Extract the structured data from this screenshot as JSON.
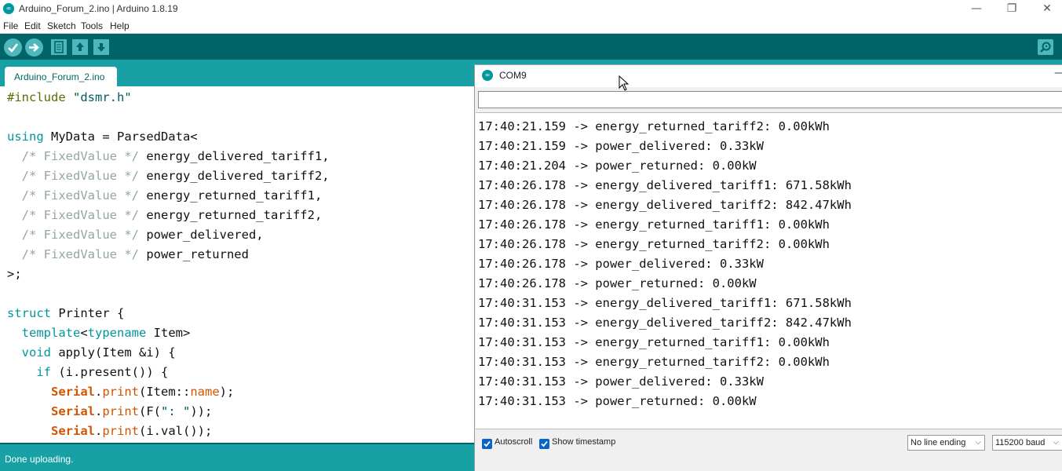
{
  "window": {
    "logo": "∞",
    "title": "Arduino_Forum_2.ino | Arduino 1.8.19",
    "controls": {
      "minimize": "—",
      "maximize": "❐",
      "close": "✕"
    }
  },
  "menu": {
    "file": "File",
    "edit": "Edit",
    "sketch": "Sketch",
    "tools": "Tools",
    "help": "Help"
  },
  "toolbar": {
    "icons": [
      "verify-icon",
      "upload-icon",
      "new-icon",
      "open-icon",
      "save-icon",
      "serial-monitor-icon"
    ],
    "colors": {
      "bar": "#006468",
      "button": "#4db7bb"
    }
  },
  "tab": {
    "label": "Arduino_Forum_2.ino"
  },
  "code": {
    "l1": {
      "pp": "#include",
      "rest": " ",
      "str": "\"dsmr.h\""
    },
    "l3": {
      "kw": "using",
      "rest": " MyData = ParsedData<"
    },
    "l4": {
      "cm": "/* FixedValue */",
      "rest": " energy_delivered_tariff1,"
    },
    "l5": {
      "cm": "/* FixedValue */",
      "rest": " energy_delivered_tariff2,"
    },
    "l6": {
      "cm": "/* FixedValue */",
      "rest": " energy_returned_tariff1,"
    },
    "l7": {
      "cm": "/* FixedValue */",
      "rest": " energy_returned_tariff2,"
    },
    "l8": {
      "cm": "/* FixedValue */",
      "rest": " power_delivered,"
    },
    "l9": {
      "cm": "/* FixedValue */",
      "rest": " power_returned"
    },
    "l10": ">;",
    "l12": {
      "kw": "struct",
      "rest": " Printer {"
    },
    "l13": {
      "kw": "template",
      "p1": "<",
      "kw2": "typename",
      "rest": " Item>"
    },
    "l14": {
      "kw": "void",
      "rest": " apply(Item &i) {"
    },
    "l15": {
      "kw": "if",
      "rest": " (i.present()) {"
    },
    "l16": {
      "ser": "Serial",
      "p1": ".",
      "fn": "print",
      "p2": "(Item::",
      "fn2": "name",
      "rest": ");"
    },
    "l17": {
      "ser": "Serial",
      "p1": ".",
      "fn": "print",
      "p2": "(F(",
      "str": "\": \"",
      "rest": "));"
    },
    "l18": {
      "ser": "Serial",
      "p1": ".",
      "fn": "print",
      "rest": "(i.val());"
    }
  },
  "status": {
    "message": "Done uploading."
  },
  "serial_monitor": {
    "title": "COM9",
    "logo": "∞",
    "input_value": "",
    "lines": [
      "17:40:21.159 -> energy_returned_tariff2: 0.00kWh",
      "17:40:21.159 -> power_delivered: 0.33kW",
      "17:40:21.204 -> power_returned: 0.00kW",
      "17:40:26.178 -> energy_delivered_tariff1: 671.58kWh",
      "17:40:26.178 -> energy_delivered_tariff2: 842.47kWh",
      "17:40:26.178 -> energy_returned_tariff1: 0.00kWh",
      "17:40:26.178 -> energy_returned_tariff2: 0.00kWh",
      "17:40:26.178 -> power_delivered: 0.33kW",
      "17:40:26.178 -> power_returned: 0.00kW",
      "17:40:31.153 -> energy_delivered_tariff1: 671.58kWh",
      "17:40:31.153 -> energy_delivered_tariff2: 842.47kWh",
      "17:40:31.153 -> energy_returned_tariff1: 0.00kWh",
      "17:40:31.153 -> energy_returned_tariff2: 0.00kWh",
      "17:40:31.153 -> power_delivered: 0.33kW",
      "17:40:31.153 -> power_returned: 0.00kW"
    ],
    "autoscroll": {
      "label": "Autoscroll",
      "checked": true
    },
    "show_timestamp": {
      "label": "Show timestamp",
      "checked": true
    },
    "line_ending": "No line ending",
    "baud": "115200 baud"
  }
}
